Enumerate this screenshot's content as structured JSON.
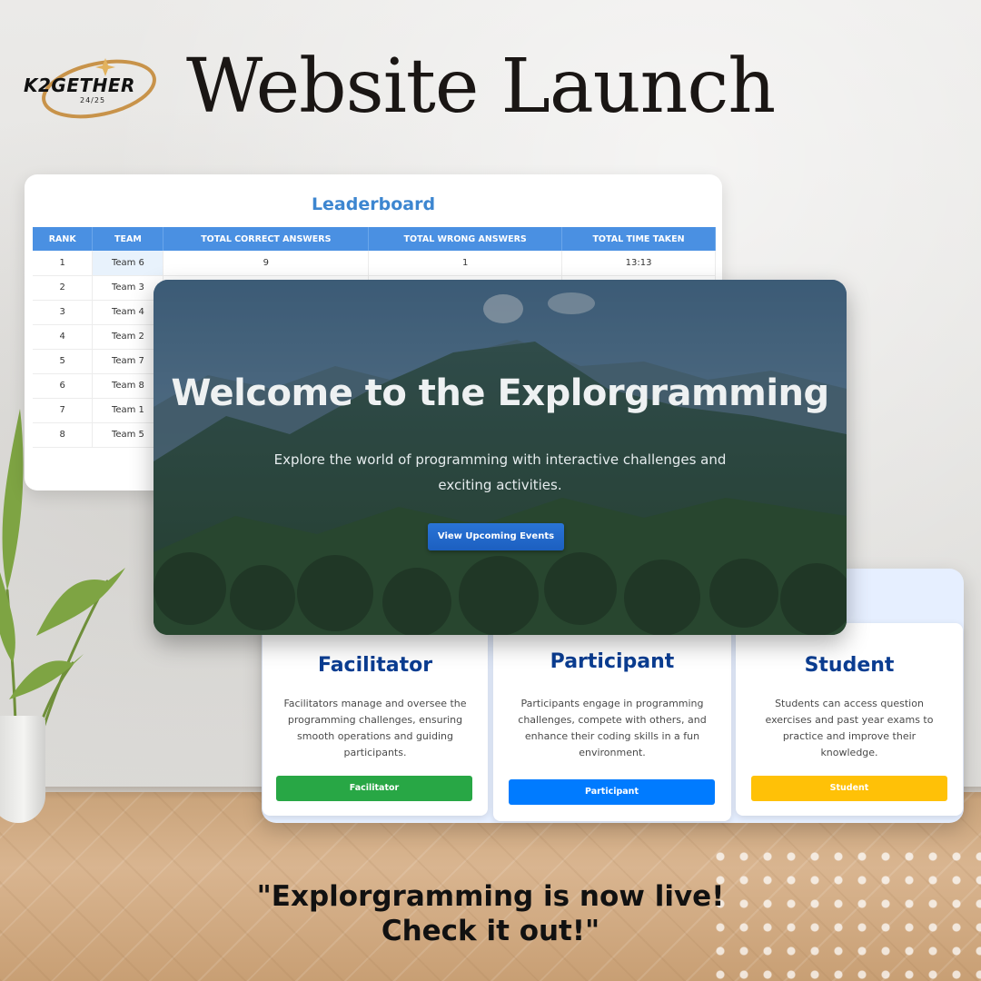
{
  "header": {
    "logo_text": "K2GETHER",
    "logo_sub": "24/25",
    "title": "Website Launch"
  },
  "leaderboard": {
    "title": "Leaderboard",
    "columns": [
      "RANK",
      "TEAM",
      "TOTAL CORRECT ANSWERS",
      "TOTAL WRONG ANSWERS",
      "TOTAL TIME TAKEN"
    ],
    "rows": [
      {
        "rank": "1",
        "team": "Team 6",
        "correct": "9",
        "wrong": "1",
        "time": "13:13"
      },
      {
        "rank": "2",
        "team": "Team 3"
      },
      {
        "rank": "3",
        "team": "Team 4"
      },
      {
        "rank": "4",
        "team": "Team 2"
      },
      {
        "rank": "5",
        "team": "Team 7"
      },
      {
        "rank": "6",
        "team": "Team 8"
      },
      {
        "rank": "7",
        "team": "Team 1"
      },
      {
        "rank": "8",
        "team": "Team 5"
      }
    ]
  },
  "hero": {
    "title": "Welcome to the Explorgramming",
    "subtitle": "Explore the world of programming with interactive challenges and exciting activities.",
    "button_label": "View Upcoming Events"
  },
  "roles": [
    {
      "name": "Facilitator",
      "description": "Facilitators manage and oversee the programming challenges, ensuring smooth operations and guiding participants.",
      "button_label": "Facilitator",
      "button_color": "#28a745"
    },
    {
      "name": "Participant",
      "description": "Participants engage in programming challenges, compete with others, and enhance their coding skills in a fun environment.",
      "button_label": "Participant",
      "button_color": "#007bff"
    },
    {
      "name": "Student",
      "description": "Students can access question exercises and past year exams to practice and improve their knowledge.",
      "button_label": "Student",
      "button_color": "#ffc107"
    }
  ],
  "quote": {
    "line1": "\"Explorgramming is now live!",
    "line2": "Check it out!\""
  },
  "colors": {
    "leaderboard_header": "#4a90e2",
    "role_title": "#0b3d91",
    "hero_button": "#1f66c9"
  },
  "icons": [
    "logo-swirl-icon",
    "sparkle-star-icon",
    "plant-icon"
  ]
}
